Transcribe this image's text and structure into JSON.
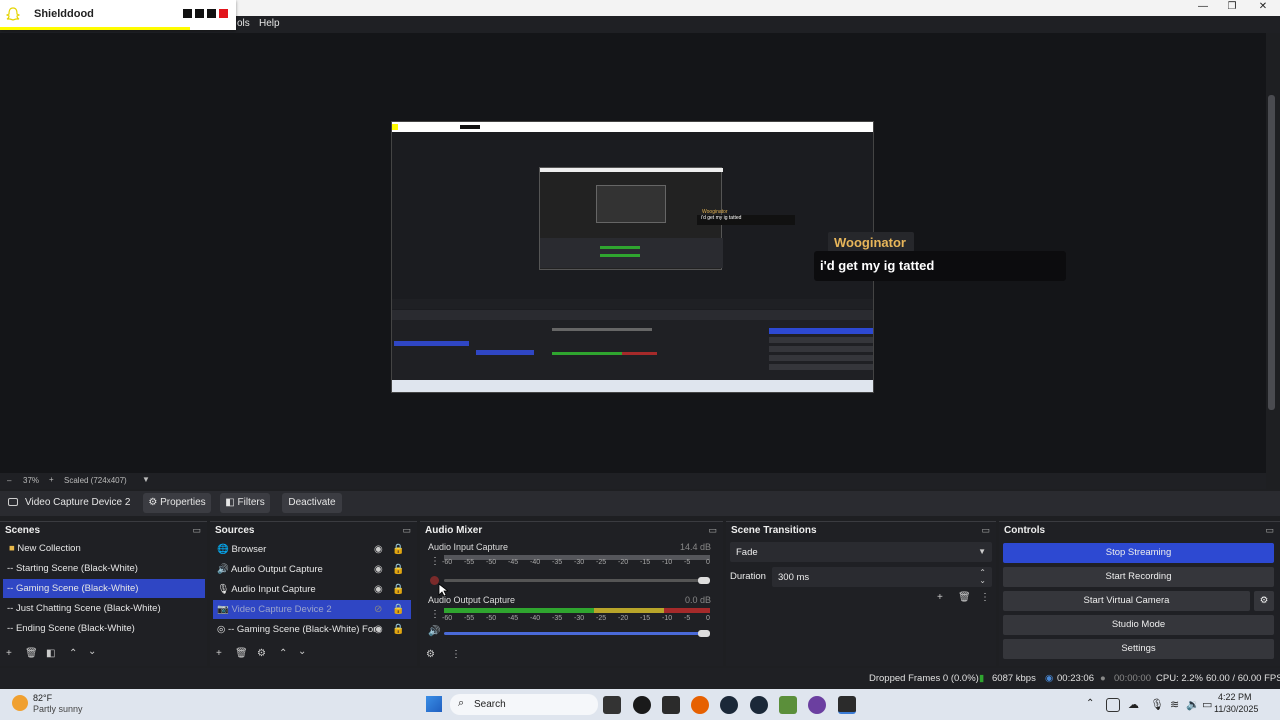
{
  "window": {
    "minimize": "—",
    "maximize": "❐",
    "close": "✕"
  },
  "menu": {
    "tools_partial": "ols",
    "help": "Help"
  },
  "snap": {
    "title": "Shielddood"
  },
  "chat": {
    "name": "Wooginator",
    "message": "i'd get my ig tatted"
  },
  "zoom": {
    "minus": "–",
    "percent": "37%",
    "plus": "+",
    "scaled": "Scaled (724x407)"
  },
  "source_toolbar": {
    "source_name": "Video Capture Device 2",
    "properties": "Properties",
    "filters": "Filters",
    "deactivate": "Deactivate"
  },
  "scenes": {
    "title": "Scenes",
    "items": [
      "New Collection",
      "-- Starting Scene (Black-White)",
      "-- Gaming Scene (Black-White)",
      "-- Just Chatting Scene (Black-White)",
      "-- Ending Scene (Black-White)"
    ],
    "selected_index": 2
  },
  "sources": {
    "title": "Sources",
    "items": [
      "Browser",
      "Audio Output Capture",
      "Audio Input Capture",
      "Video Capture Device 2",
      "-- Gaming Scene (Black-White)  Fore"
    ],
    "selected_index": 3
  },
  "mixer": {
    "title": "Audio Mixer",
    "channels": [
      {
        "name": "Audio Input Capture",
        "db": "14.4 dB",
        "level": 0.0,
        "volume": 1.0
      },
      {
        "name": "Audio Output Capture",
        "db": "0.0 dB",
        "level": 0.6,
        "volume": 1.0
      }
    ],
    "scale": [
      "-60",
      "-55",
      "-50",
      "-45",
      "-40",
      "-35",
      "-30",
      "-25",
      "-20",
      "-15",
      "-10",
      "-5",
      "0"
    ]
  },
  "transitions": {
    "title": "Scene Transitions",
    "selected": "Fade",
    "duration_label": "Duration",
    "duration_value": "300 ms"
  },
  "controls": {
    "title": "Controls",
    "stop_streaming": "Stop Streaming",
    "start_recording": "Start Recording",
    "start_virtual_camera": "Start Virtual Camera",
    "studio_mode": "Studio Mode",
    "settings": "Settings"
  },
  "status": {
    "dropped_frames": "Dropped Frames 0 (0.0%)",
    "bitrate": "6087 kbps",
    "stream_time": "00:23:06",
    "rec_time": "00:00:00",
    "cpu": "CPU: 2.2%",
    "fps": "60.00 / 60.00 FPS"
  },
  "taskbar": {
    "temp": "82°F",
    "weather": "Partly sunny",
    "search": "Search",
    "time": "4:22 PM",
    "date": "11/30/2025"
  },
  "colors": {
    "accent": "#2d49d2",
    "snap_yellow": "#fffc00",
    "meter_green": "#2fa52f",
    "meter_yellow": "#b8a52a",
    "meter_red": "#a52a2a"
  }
}
